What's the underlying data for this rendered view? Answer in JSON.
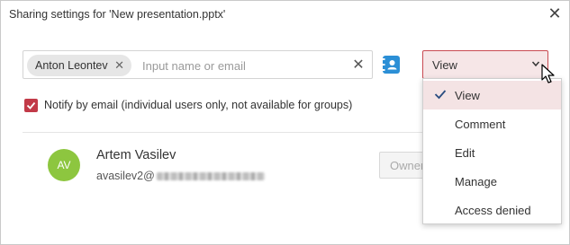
{
  "dialog": {
    "title": "Sharing settings for 'New presentation.pptx'",
    "close_icon": "close-icon"
  },
  "invite": {
    "chip_label": "Anton Leontev",
    "placeholder": "Input name or email",
    "clear_icon": "close-icon",
    "address_book_icon": "address-book-icon"
  },
  "role_select": {
    "value": "View",
    "options": [
      {
        "label": "View",
        "selected": true
      },
      {
        "label": "Comment",
        "selected": false
      },
      {
        "label": "Edit",
        "selected": false
      },
      {
        "label": "Manage",
        "selected": false
      },
      {
        "label": "Access denied",
        "selected": false
      }
    ]
  },
  "notify": {
    "label": "Notify by email (individual users only, not available for groups)",
    "checked": true
  },
  "shared_user": {
    "initials": "AV",
    "name": "Artem Vasilev",
    "email_prefix": "avasilev2@",
    "role_label": "Owner"
  },
  "colors": {
    "accent": "#c23a48",
    "select_bg": "#f6e6e7",
    "avatar": "#8dc63f",
    "address_book": "#2b8fd6"
  }
}
